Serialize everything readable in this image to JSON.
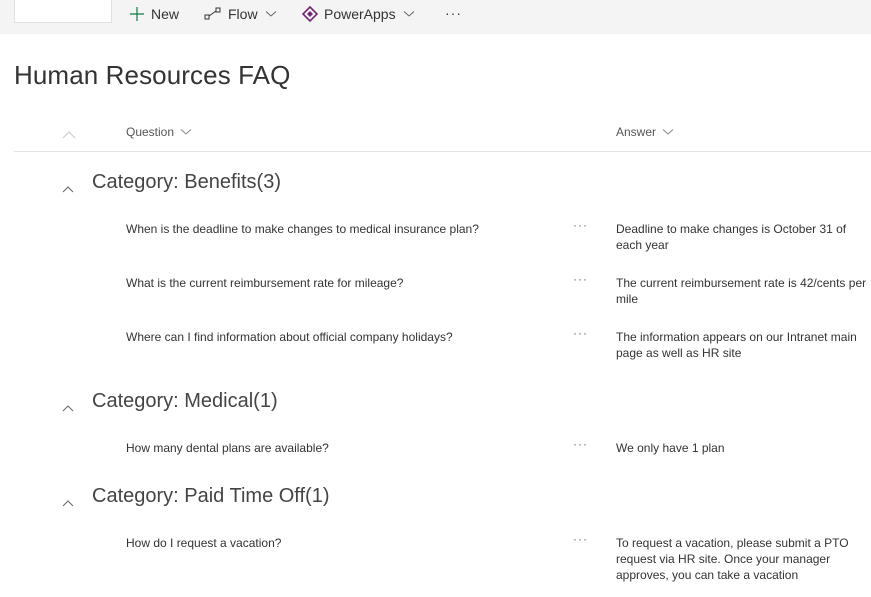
{
  "toolbar": {
    "new_label": "New",
    "flow_label": "Flow",
    "powerapps_label": "PowerApps",
    "more_label": "···",
    "powerapps_color": "#742774",
    "new_icon_color": "#107c41"
  },
  "page": {
    "title": "Human Resources FAQ"
  },
  "columns": {
    "question": "Question",
    "answer": "Answer"
  },
  "groups": [
    {
      "title": "Category: Benefits(3)",
      "rows": [
        {
          "question": "When is the deadline to make changes to medical insurance plan?",
          "answer": "Deadline to make changes is October 31 of each year"
        },
        {
          "question": "What is the current reimbursement rate for mileage?",
          "answer": "The current reimbursement rate is 42/cents per mile"
        },
        {
          "question": "Where can I find information about official company holidays?",
          "answer": "The information appears on our Intranet main page as well as HR site"
        }
      ]
    },
    {
      "title": "Category: Medical(1)",
      "rows": [
        {
          "question": "How many dental plans are available?",
          "answer": "We only have 1 plan"
        }
      ]
    },
    {
      "title": "Category: Paid Time Off(1)",
      "rows": [
        {
          "question": "How do I request a vacation?",
          "answer": "To request a vacation, please submit a PTO request via HR site. Once your manager approves, you can take a vacation"
        }
      ]
    }
  ],
  "row_more_label": "···"
}
